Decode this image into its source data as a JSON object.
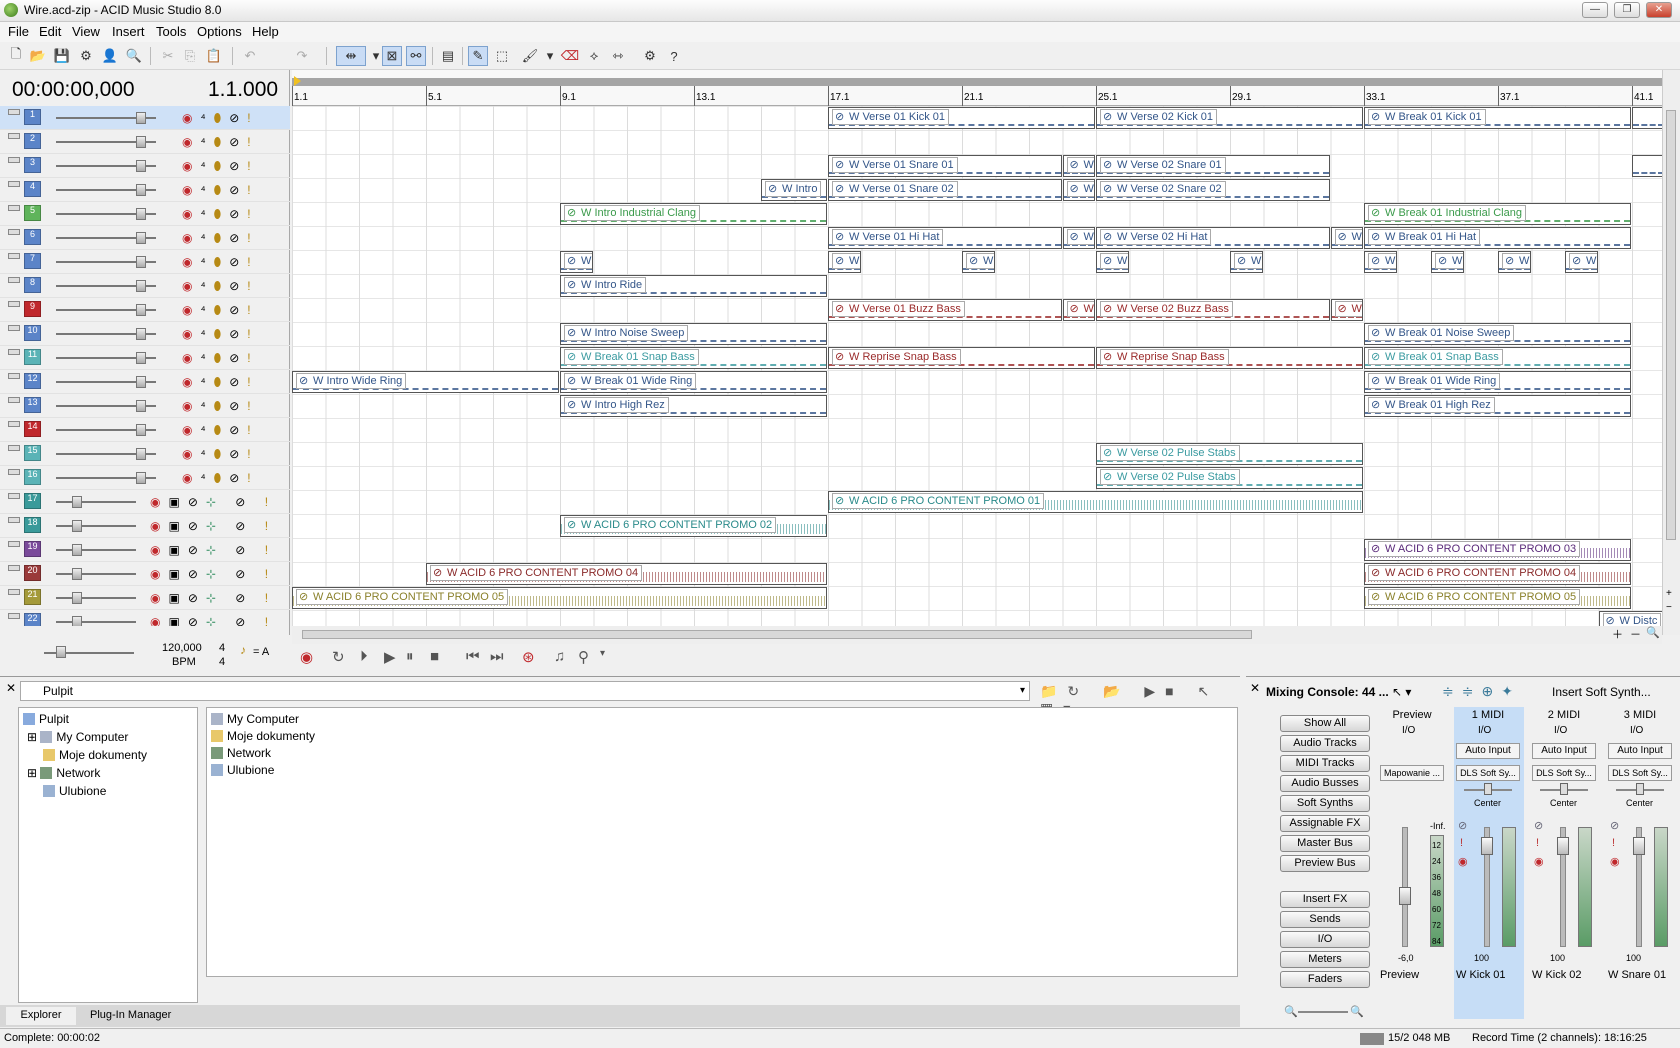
{
  "window": {
    "title": "Wire.acd-zip - ACID Music Studio 8.0",
    "min": "—",
    "max": "❐",
    "close": "✕"
  },
  "menu": [
    "File",
    "Edit",
    "View",
    "Insert",
    "Tools",
    "Options",
    "Help"
  ],
  "timeline": {
    "timecode": "00:00:00,000",
    "measure": "1.1.000",
    "bpm": "120,000",
    "bpm_label": "BPM",
    "sig_top": "4",
    "sig_bottom": "4",
    "metro": "= A",
    "ruler": [
      "1.1",
      "5.1",
      "9.1",
      "13.1",
      "17.1",
      "21.1",
      "25.1",
      "29.1",
      "33.1",
      "37.1",
      "41.1"
    ]
  },
  "tracks": [
    {
      "n": "1",
      "color": "#5b84c8"
    },
    {
      "n": "2",
      "color": "#5b84c8"
    },
    {
      "n": "3",
      "color": "#5b84c8"
    },
    {
      "n": "4",
      "color": "#5b84c8"
    },
    {
      "n": "5",
      "color": "#5fb45b"
    },
    {
      "n": "6",
      "color": "#5b84c8"
    },
    {
      "n": "7",
      "color": "#5b84c8"
    },
    {
      "n": "8",
      "color": "#5b84c8"
    },
    {
      "n": "9",
      "color": "#c0282c"
    },
    {
      "n": "10",
      "color": "#5b84c8"
    },
    {
      "n": "11",
      "color": "#5ab3b6"
    },
    {
      "n": "12",
      "color": "#5b84c8"
    },
    {
      "n": "13",
      "color": "#5b84c8"
    },
    {
      "n": "14",
      "color": "#c0282c"
    },
    {
      "n": "15",
      "color": "#5ab3b6"
    },
    {
      "n": "16",
      "color": "#5ab3b6"
    },
    {
      "n": "17",
      "color": "#3a9a9a"
    },
    {
      "n": "18",
      "color": "#3a9a9a"
    },
    {
      "n": "19",
      "color": "#7a4a9a"
    },
    {
      "n": "20",
      "color": "#9a3a3a"
    },
    {
      "n": "21",
      "color": "#a49a3a"
    },
    {
      "n": "22",
      "color": "#5b84c8"
    }
  ],
  "clips": [
    {
      "row": 0,
      "m": 16,
      "len": 8,
      "t": "W Verse 01 Kick 01",
      "c": "#335588"
    },
    {
      "row": 0,
      "m": 24,
      "len": 8,
      "t": "W Verse 02 Kick 01",
      "c": "#335588"
    },
    {
      "row": 0,
      "m": 32,
      "len": 8,
      "t": "W Break 01 Kick 01",
      "c": "#335588"
    },
    {
      "row": 0,
      "m": 40,
      "len": 1,
      "t": "",
      "c": "#335588"
    },
    {
      "row": 2,
      "m": 16,
      "len": 7,
      "t": "W Verse 01 Snare 01",
      "c": "#335588"
    },
    {
      "row": 2,
      "m": 23,
      "len": 1,
      "t": "W",
      "c": "#335588"
    },
    {
      "row": 2,
      "m": 24,
      "len": 7,
      "t": "W Verse 02 Snare 01",
      "c": "#335588"
    },
    {
      "row": 2,
      "m": 40,
      "len": 1,
      "t": "",
      "c": "#335588"
    },
    {
      "row": 3,
      "m": 14,
      "len": 2,
      "t": "W Intro",
      "c": "#335588"
    },
    {
      "row": 3,
      "m": 16,
      "len": 7,
      "t": "W Verse 01 Snare 02",
      "c": "#335588"
    },
    {
      "row": 3,
      "m": 23,
      "len": 1,
      "t": "W",
      "c": "#335588"
    },
    {
      "row": 3,
      "m": 24,
      "len": 7,
      "t": "W Verse 02 Snare 02",
      "c": "#335588"
    },
    {
      "row": 4,
      "m": 8,
      "len": 8,
      "t": "W Intro Industrial Clang",
      "c": "#3a9a4a"
    },
    {
      "row": 4,
      "m": 32,
      "len": 8,
      "t": "W Break 01 Industrial Clang",
      "c": "#3a9a4a"
    },
    {
      "row": 5,
      "m": 16,
      "len": 7,
      "t": "W Verse 01 Hi Hat",
      "c": "#335588"
    },
    {
      "row": 5,
      "m": 23,
      "len": 1,
      "t": "W",
      "c": "#335588"
    },
    {
      "row": 5,
      "m": 24,
      "len": 7,
      "t": "W Verse 02 Hi Hat",
      "c": "#335588"
    },
    {
      "row": 5,
      "m": 31,
      "len": 1,
      "t": "W",
      "c": "#335588"
    },
    {
      "row": 5,
      "m": 32,
      "len": 8,
      "t": "W Break 01 Hi Hat",
      "c": "#335588"
    },
    {
      "row": 6,
      "m": 8,
      "len": 1,
      "t": "W",
      "c": "#335588"
    },
    {
      "row": 6,
      "m": 16,
      "len": 1,
      "t": "W",
      "c": "#335588"
    },
    {
      "row": 6,
      "m": 20,
      "len": 1,
      "t": "W",
      "c": "#335588"
    },
    {
      "row": 6,
      "m": 24,
      "len": 1,
      "t": "W",
      "c": "#335588"
    },
    {
      "row": 6,
      "m": 28,
      "len": 1,
      "t": "W",
      "c": "#335588"
    },
    {
      "row": 6,
      "m": 32,
      "len": 1,
      "t": "W",
      "c": "#335588"
    },
    {
      "row": 6,
      "m": 34,
      "len": 1,
      "t": "W",
      "c": "#335588"
    },
    {
      "row": 6,
      "m": 36,
      "len": 1,
      "t": "W",
      "c": "#335588"
    },
    {
      "row": 6,
      "m": 38,
      "len": 1,
      "t": "W",
      "c": "#335588"
    },
    {
      "row": 7,
      "m": 8,
      "len": 8,
      "t": "W Intro Ride",
      "c": "#335588"
    },
    {
      "row": 8,
      "m": 16,
      "len": 7,
      "t": "W Verse 01 Buzz Bass",
      "c": "#9a2a2a"
    },
    {
      "row": 8,
      "m": 23,
      "len": 1,
      "t": "W",
      "c": "#9a2a2a"
    },
    {
      "row": 8,
      "m": 24,
      "len": 7,
      "t": "W Verse 02 Buzz Bass",
      "c": "#9a2a2a"
    },
    {
      "row": 8,
      "m": 31,
      "len": 1,
      "t": "W",
      "c": "#9a2a2a"
    },
    {
      "row": 9,
      "m": 8,
      "len": 8,
      "t": "W Intro Noise Sweep",
      "c": "#335588"
    },
    {
      "row": 9,
      "m": 32,
      "len": 8,
      "t": "W Break 01 Noise Sweep",
      "c": "#335588"
    },
    {
      "row": 10,
      "m": 8,
      "len": 8,
      "t": "W Break 01 Snap Bass",
      "c": "#3a9aa0"
    },
    {
      "row": 10,
      "m": 16,
      "len": 8,
      "t": "W Reprise Snap Bass",
      "c": "#9a2a2a"
    },
    {
      "row": 10,
      "m": 24,
      "len": 8,
      "t": "W Reprise Snap Bass",
      "c": "#9a2a2a"
    },
    {
      "row": 10,
      "m": 32,
      "len": 8,
      "t": "W Break 01 Snap Bass",
      "c": "#3a9aa0"
    },
    {
      "row": 11,
      "m": 0,
      "len": 8,
      "t": "W Intro Wide Ring",
      "c": "#335588"
    },
    {
      "row": 11,
      "m": 8,
      "len": 8,
      "t": "W Break 01 Wide Ring",
      "c": "#335588"
    },
    {
      "row": 11,
      "m": 32,
      "len": 8,
      "t": "W Break 01 Wide Ring",
      "c": "#335588"
    },
    {
      "row": 12,
      "m": 8,
      "len": 8,
      "t": "W Intro High Rez",
      "c": "#335588"
    },
    {
      "row": 12,
      "m": 32,
      "len": 8,
      "t": "W Break 01 High Rez",
      "c": "#335588"
    },
    {
      "row": 14,
      "m": 24,
      "len": 8,
      "t": "W Verse 02 Pulse Stabs",
      "c": "#3a9aa0"
    },
    {
      "row": 15,
      "m": 24,
      "len": 8,
      "t": "W Verse 02 Pulse Stabs",
      "c": "#3a9aa0"
    },
    {
      "row": 16,
      "m": 16,
      "len": 16,
      "t": "W ACID 6 PRO CONTENT PROMO 01",
      "c": "#2a8a8a"
    },
    {
      "row": 17,
      "m": 8,
      "len": 8,
      "t": "W ACID 6 PRO CONTENT PROMO 02",
      "c": "#2a8a8a"
    },
    {
      "row": 18,
      "m": 32,
      "len": 8,
      "t": "W ACID 6 PRO CONTENT PROMO 03",
      "c": "#5a2a7a"
    },
    {
      "row": 19,
      "m": 4,
      "len": 12,
      "t": "W ACID 6 PRO CONTENT PROMO 04",
      "c": "#8a2a2a"
    },
    {
      "row": 19,
      "m": 32,
      "len": 8,
      "t": "W ACID 6 PRO CONTENT PROMO 04",
      "c": "#8a2a2a"
    },
    {
      "row": 20,
      "m": 0,
      "len": 16,
      "t": "W ACID 6 PRO CONTENT PROMO 05",
      "c": "#8a802a"
    },
    {
      "row": 20,
      "m": 32,
      "len": 8,
      "t": "W ACID 6 PRO CONTENT PROMO 05",
      "c": "#8a802a"
    },
    {
      "row": 21,
      "m": 39,
      "len": 2,
      "t": "W Distc",
      "c": "#335588"
    }
  ],
  "explorer": {
    "path": "Pulpit",
    "tree": [
      "Pulpit",
      "My Computer",
      "Moje dokumenty",
      "Network",
      "Ulubione"
    ],
    "files": [
      "My Computer",
      "Moje dokumenty",
      "Network",
      "Ulubione"
    ],
    "tabs": [
      "Explorer",
      "Plug-In Manager"
    ]
  },
  "mixer": {
    "title": "Mixing Console: 44 ...",
    "insert": "Insert Soft Synth...",
    "buttons": [
      "Show All",
      "Audio Tracks",
      "MIDI Tracks",
      "Audio Busses",
      "Soft Synths",
      "Assignable FX",
      "Master Bus",
      "Preview Bus"
    ],
    "buttons2": [
      "Insert FX",
      "Sends",
      "I/O",
      "Meters",
      "Faders"
    ],
    "strips": [
      {
        "hd": "Preview",
        "io": "I/O",
        "slot1": "",
        "slot2": "Mapowanie ...",
        "pan": "",
        "vol": "-6,0",
        "peak": "-Inf.",
        "bottom": "Preview",
        "sel": false
      },
      {
        "hd": "1 MIDI",
        "io": "I/O",
        "slot1": "Auto Input",
        "slot2": "DLS Soft Sy...",
        "pan": "Center",
        "vol": "100",
        "peak": "",
        "bottom": "W Kick 01",
        "sel": true
      },
      {
        "hd": "2 MIDI",
        "io": "I/O",
        "slot1": "Auto Input",
        "slot2": "DLS Soft Sy...",
        "pan": "Center",
        "vol": "100",
        "peak": "",
        "bottom": "W Kick 02",
        "sel": false
      },
      {
        "hd": "3 MIDI",
        "io": "I/O",
        "slot1": "Auto Input",
        "slot2": "DLS Soft Sy...",
        "pan": "Center",
        "vol": "100",
        "peak": "",
        "bottom": "W Snare 01",
        "sel": false
      }
    ],
    "meter_labels": [
      "12",
      "24",
      "36",
      "48",
      "60",
      "72",
      "84"
    ]
  },
  "status": {
    "left": "Complete: 00:00:02",
    "mem": "15/2 048 MB",
    "rec": "Record Time (2 channels): 18:16:25"
  }
}
